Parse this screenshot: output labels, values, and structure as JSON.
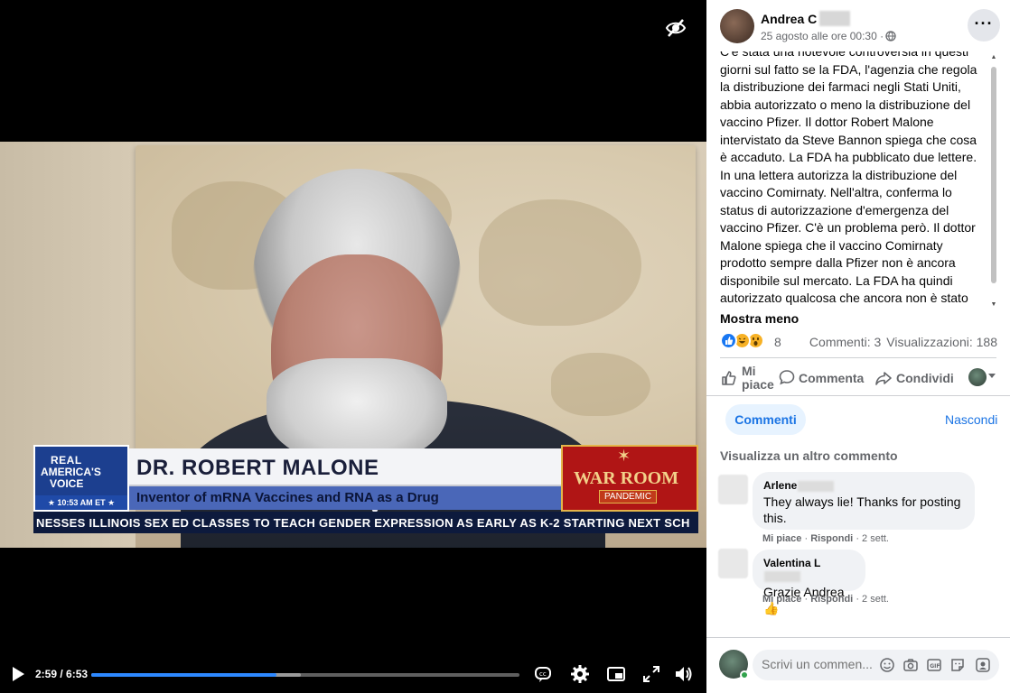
{
  "video": {
    "lower_third": {
      "brand_line1": "REAL",
      "brand_line2": "AMERICA'S",
      "brand_line3": "VOICE",
      "clock": "★ 10:53 AM ET ★",
      "name": "DR. ROBERT MALONE",
      "subtitle": "Inventor of mRNA Vaccines and RNA as a Drug",
      "show_name": "WAR ROOM",
      "show_badge": "PANDEMIC",
      "ticker": "NESSES   ILLINOIS SEX ED CLASSES TO TEACH GENDER EXPRESSION AS EARLY AS K-2 STARTING NEXT SCH"
    },
    "controls": {
      "time": "2:59 / 6:53",
      "progress_fraction": 0.433,
      "buffered_fraction": 0.49
    },
    "colors": {
      "accent": "#2d88ff"
    }
  },
  "post": {
    "author": "Andrea C",
    "timestamp": "25 agosto alle ore 00:30 ·",
    "text": "C'è stata una notevole controversia in questi giorni sul fatto se la FDA, l'agenzia che regola la distribuzione dei farmaci negli Stati Uniti, abbia autorizzato o meno la distribuzione del vaccino Pfizer. Il dottor Robert Malone intervistato da Steve Bannon spiega che cosa è accaduto. La FDA ha pubblicato due lettere. In una lettera autorizza la distribuzione del vaccino Comirnaty. Nell'altra, conferma lo status di autorizzazione d'emergenza del vaccino Pfizer. C'è un problema però. Il dottor Malone spiega che il vaccino Comirnaty prodotto sempre dalla Pfizer non è ancora disponibile sul mercato. La FDA ha quindi autorizzato qualcosa che ancora non è stato distribuito. La FDA e i media hanno giocato",
    "show_less": "Mostra meno",
    "reaction_count": "8",
    "comments_count": "Commenti: 3",
    "views_count": "Visualizzazioni: 188",
    "actions": {
      "like": "Mi piace",
      "comment": "Commenta",
      "share": "Condividi"
    }
  },
  "comments_section": {
    "tab": "Commenti",
    "hide": "Nascondi",
    "view_more": "Visualizza un altro commento",
    "items": [
      {
        "name": "Arlene",
        "text": "They always lie! Thanks for posting this.",
        "like": "Mi piace",
        "reply": "Rispondi",
        "age": "· 2 sett."
      },
      {
        "name": "Valentina L",
        "text": "Grazie Andrea👍",
        "like": "Mi piace",
        "reply": "Rispondi",
        "age": "· 2 sett."
      }
    ],
    "input_placeholder": "Scrivi un commen..."
  }
}
